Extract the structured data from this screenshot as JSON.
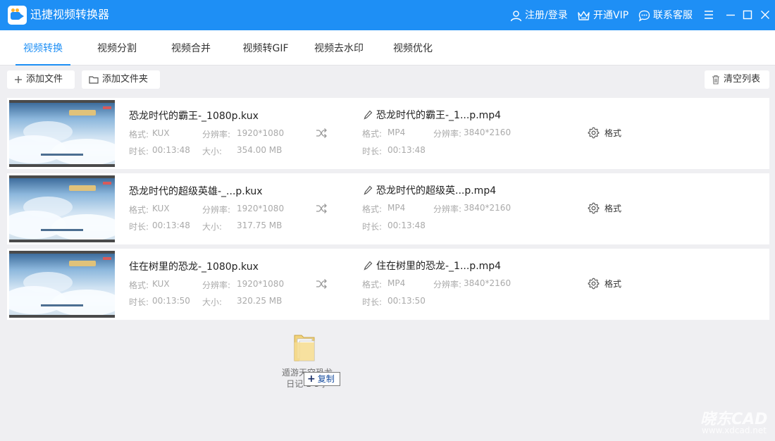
{
  "app": {
    "title": "迅捷视频转换器"
  },
  "titlebar": {
    "login": "注册/登录",
    "vip": "开通VIP",
    "support": "联系客服"
  },
  "tabs": [
    {
      "label": "视频转换",
      "active": true
    },
    {
      "label": "视频分割"
    },
    {
      "label": "视频合并"
    },
    {
      "label": "视频转GIF"
    },
    {
      "label": "视频去水印"
    },
    {
      "label": "视频优化"
    }
  ],
  "toolbar": {
    "add_file": "添加文件",
    "add_folder": "添加文件夹",
    "clear_list": "清空列表"
  },
  "files": [
    {
      "name": "恐龙时代的霸王-_1080p.kux",
      "format_label": "格式:",
      "format": "KUX",
      "resolution_label": "分辨率:",
      "resolution": "1920*1080",
      "duration_label": "时长:",
      "duration": "00:13:48",
      "size_label": "大小:",
      "size": "354.00 MB",
      "output": {
        "name": "恐龙时代的霸王-_1...p.mp4",
        "format_label": "格式:",
        "format": "MP4",
        "resolution_label": "分辨率:",
        "resolution": "3840*2160",
        "duration_label": "时长:",
        "duration": "00:13:48"
      },
      "settings_label": "格式"
    },
    {
      "name": "恐龙时代的超级英雄-_...p.kux",
      "format_label": "格式:",
      "format": "KUX",
      "resolution_label": "分辨率:",
      "resolution": "1920*1080",
      "duration_label": "时长:",
      "duration": "00:13:48",
      "size_label": "大小:",
      "size": "317.75 MB",
      "output": {
        "name": "恐龙时代的超级英...p.mp4",
        "format_label": "格式:",
        "format": "MP4",
        "resolution_label": "分辨率:",
        "resolution": "3840*2160",
        "duration_label": "时长:",
        "duration": "00:13:48"
      },
      "settings_label": "格式"
    },
    {
      "name": "住在树里的恐龙-_1080p.kux",
      "format_label": "格式:",
      "format": "KUX",
      "resolution_label": "分辨率:",
      "resolution": "1920*1080",
      "duration_label": "时长:",
      "duration": "00:13:50",
      "size_label": "大小:",
      "size": "320.25 MB",
      "output": {
        "name": "住在树里的恐龙-_1...p.mp4",
        "format_label": "格式:",
        "format": "MP4",
        "resolution_label": "分辨率:",
        "resolution": "3840*2160",
        "duration_label": "时长:",
        "duration": "00:13:50"
      },
      "settings_label": "格式"
    }
  ],
  "drag": {
    "folder_name_line1": "遁游天空恐龙",
    "folder_name_line2": "日记 1-3季",
    "copy_label": "复制"
  },
  "watermark": {
    "brand": "晓东CAD",
    "url": "www.xdcad.net"
  },
  "colors": {
    "accent": "#1e8ff5",
    "background": "#efeff2"
  }
}
